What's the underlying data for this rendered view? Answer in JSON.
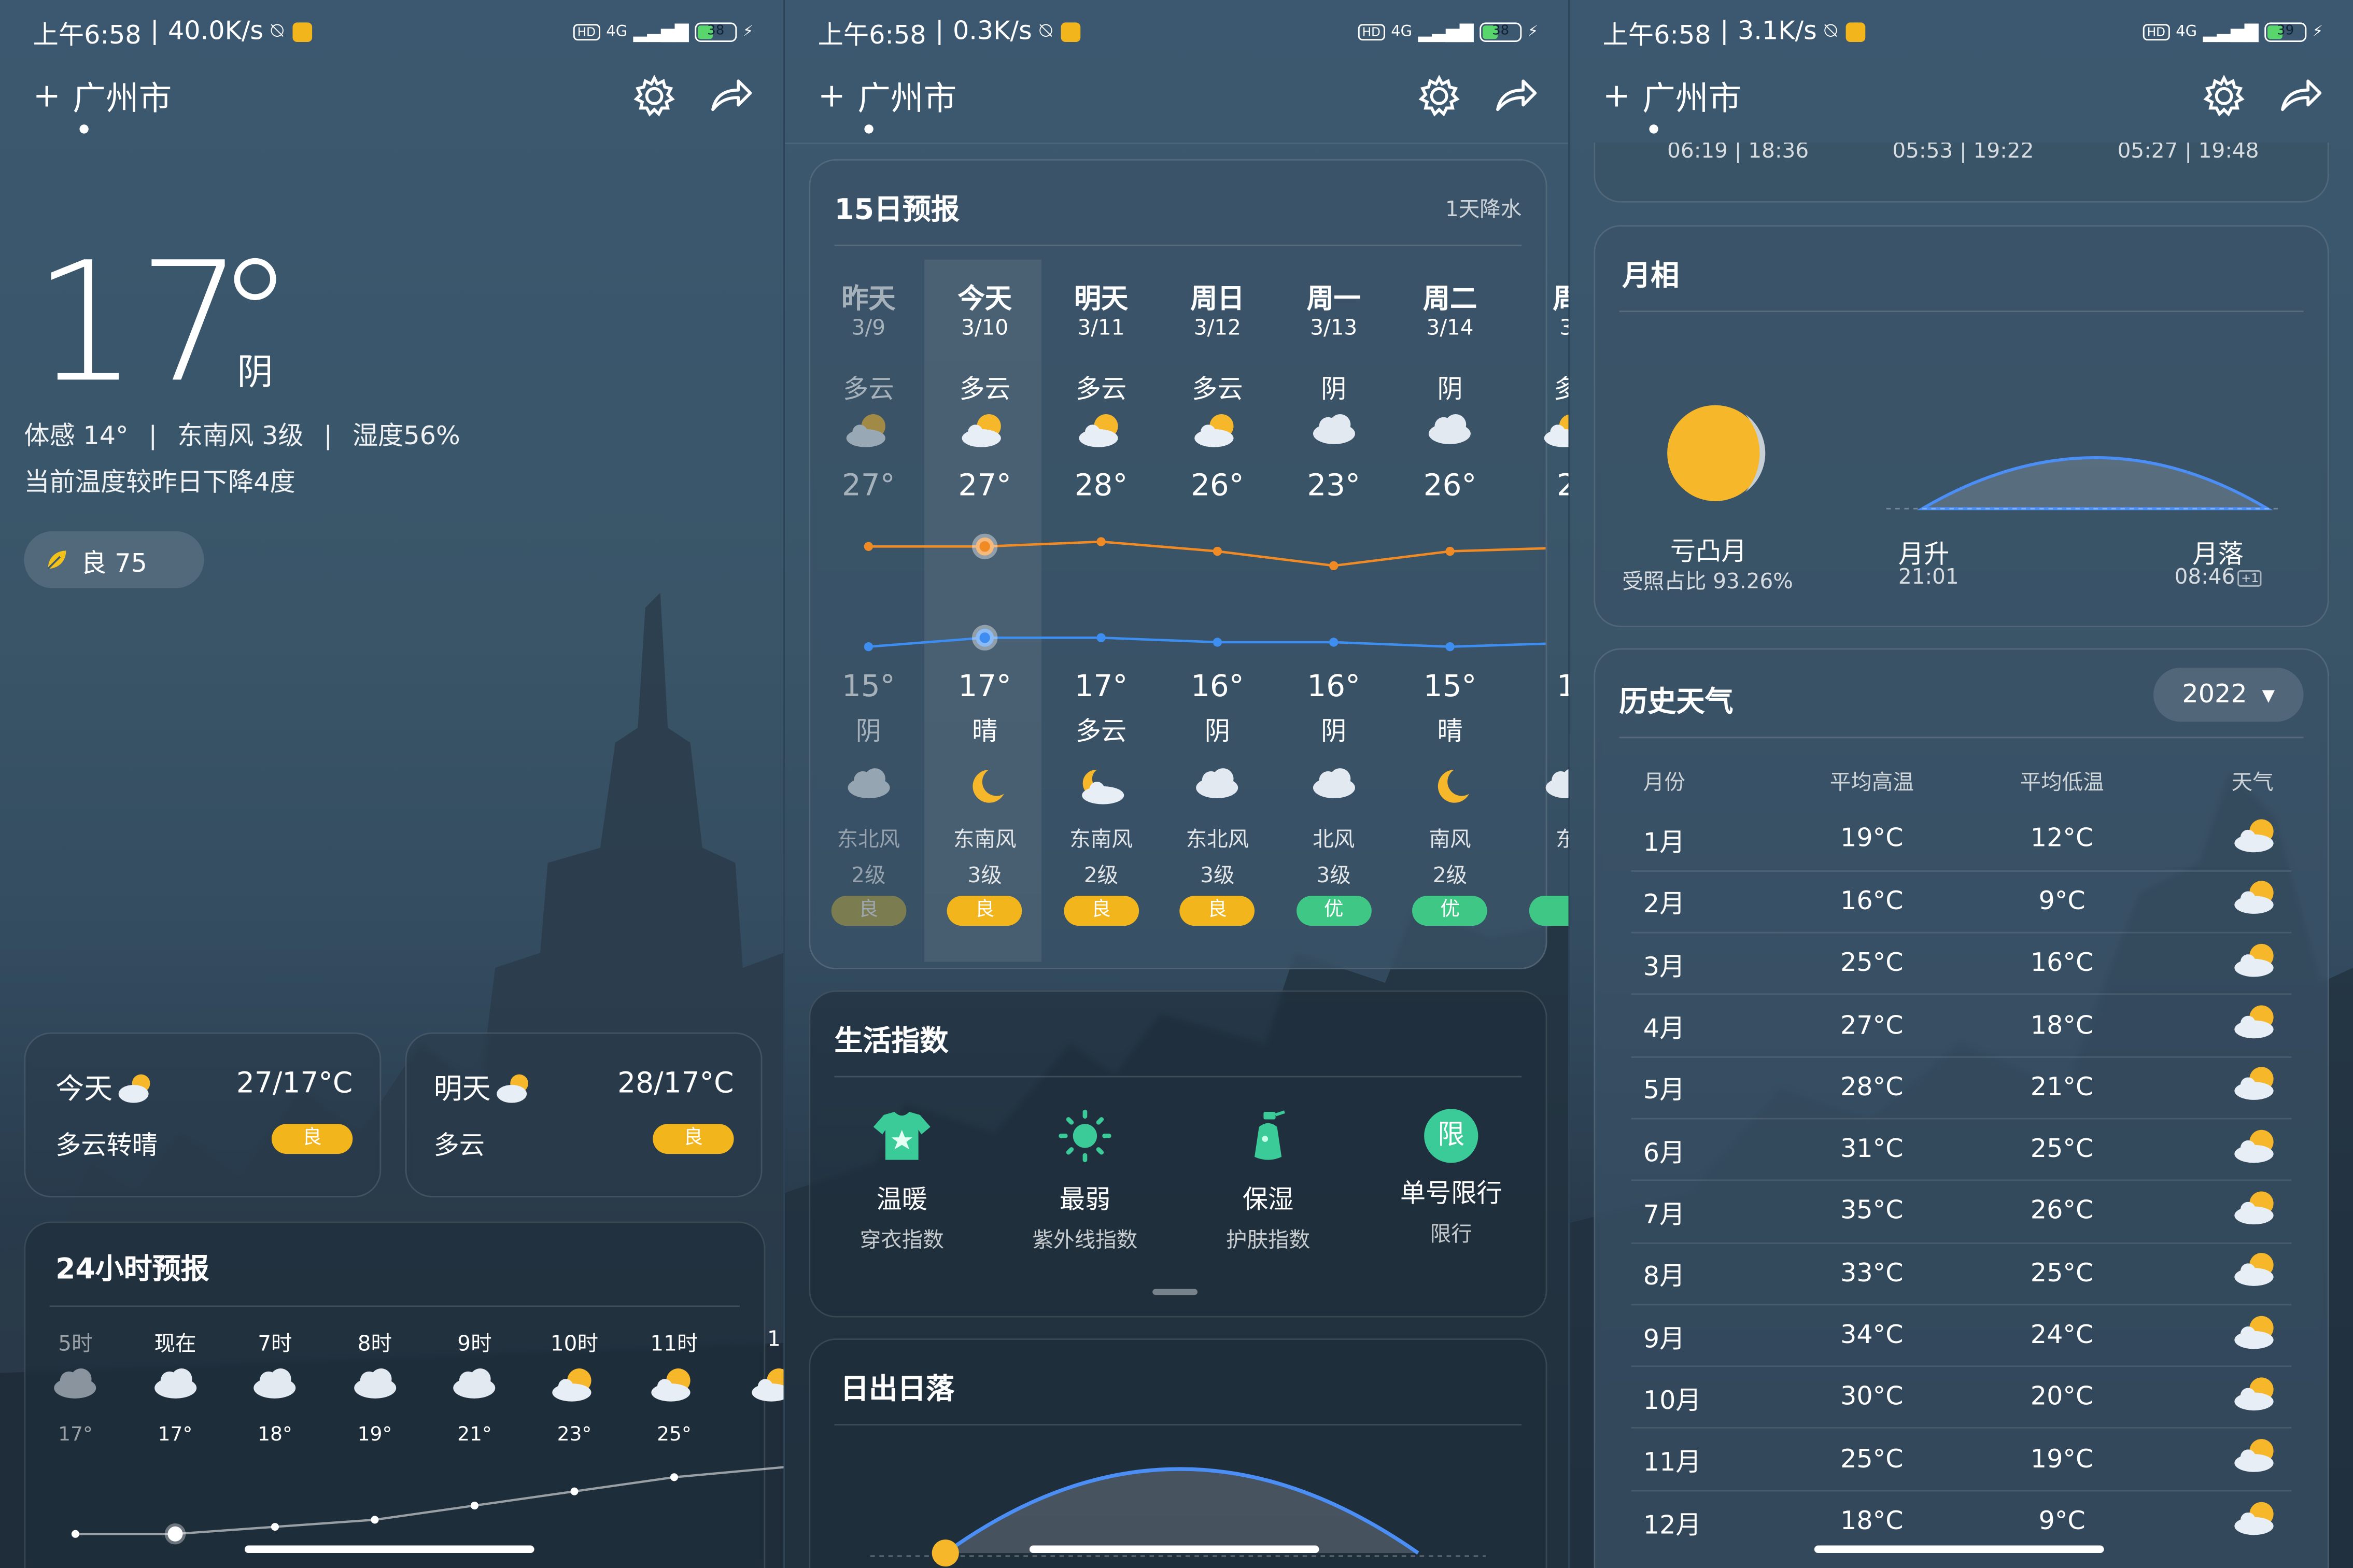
{
  "status_bar": [
    {
      "time": "上午6:58",
      "speed": "40.0K/s",
      "battery": "38"
    },
    {
      "time": "上午6:58",
      "speed": "0.3K/s",
      "battery": "38"
    },
    {
      "time": "上午6:58",
      "speed": "3.1K/s",
      "battery": "39"
    }
  ],
  "status_labels": {
    "hd": "HD",
    "net": "4G",
    "sep": "|"
  },
  "header": {
    "add": "+",
    "city": "广州市"
  },
  "current": {
    "temp": "17",
    "condition": "阴",
    "feels": "体感 14°",
    "wind": "东南风 3级",
    "humidity": "湿度56%",
    "compare": "当前温度较昨日下降4度",
    "aqi": "良 75"
  },
  "summary_cards": [
    {
      "day": "今天",
      "range": "27/17°C",
      "desc": "多云转晴",
      "aqi": "良"
    },
    {
      "day": "明天",
      "range": "28/17°C",
      "desc": "多云",
      "aqi": "良"
    }
  ],
  "hourly": {
    "title": "24小时预报",
    "hours": [
      {
        "time": "5时",
        "temp": "17°",
        "icon": "cloud-icon",
        "past": true
      },
      {
        "time": "现在",
        "temp": "17°",
        "icon": "cloud-icon"
      },
      {
        "time": "7时",
        "temp": "18°",
        "icon": "cloud-icon"
      },
      {
        "time": "8时",
        "temp": "19°",
        "icon": "cloud-icon"
      },
      {
        "time": "9时",
        "temp": "21°",
        "icon": "cloud-icon"
      },
      {
        "time": "10时",
        "temp": "23°",
        "icon": "partly-sunny-icon"
      },
      {
        "time": "11时",
        "temp": "25°",
        "icon": "partly-sunny-icon"
      },
      {
        "time": "1",
        "temp": "",
        "icon": "partly-sunny-icon"
      }
    ]
  },
  "forecast15": {
    "title": "15日预报",
    "note": "1天降水",
    "days": [
      {
        "day": "昨天",
        "date": "3/9",
        "day_cond": "多云",
        "high": "27°",
        "low": "15°",
        "night_cond": "阴",
        "wind": "东北风",
        "level": "2级",
        "aqi": "良",
        "day_icon": "partly-cloudy-icon",
        "night_icon": "cloud-icon",
        "past": true
      },
      {
        "day": "今天",
        "date": "3/10",
        "day_cond": "多云",
        "high": "27°",
        "low": "17°",
        "night_cond": "晴",
        "wind": "东南风",
        "level": "3级",
        "aqi": "良",
        "day_icon": "partly-cloudy-icon",
        "night_icon": "moon-icon"
      },
      {
        "day": "明天",
        "date": "3/11",
        "day_cond": "多云",
        "high": "28°",
        "low": "17°",
        "night_cond": "多云",
        "wind": "东南风",
        "level": "2级",
        "aqi": "良",
        "day_icon": "partly-cloudy-icon",
        "night_icon": "moon-cloud-icon"
      },
      {
        "day": "周日",
        "date": "3/12",
        "day_cond": "多云",
        "high": "26°",
        "low": "16°",
        "night_cond": "阴",
        "wind": "东北风",
        "level": "3级",
        "aqi": "良",
        "day_icon": "partly-cloudy-icon",
        "night_icon": "cloud-icon"
      },
      {
        "day": "周一",
        "date": "3/13",
        "day_cond": "阴",
        "high": "23°",
        "low": "16°",
        "night_cond": "阴",
        "wind": "北风",
        "level": "3级",
        "aqi": "优",
        "day_icon": "cloud-icon",
        "night_icon": "cloud-icon"
      },
      {
        "day": "周二",
        "date": "3/14",
        "day_cond": "阴",
        "high": "26°",
        "low": "15°",
        "night_cond": "晴",
        "wind": "南风",
        "level": "2级",
        "aqi": "优",
        "day_icon": "cloud-icon",
        "night_icon": "moon-icon"
      },
      {
        "day": "周",
        "date": "3",
        "day_cond": "多",
        "high": "2",
        "low": "1",
        "night_cond": "",
        "wind": "东",
        "level": "",
        "aqi": "",
        "day_icon": "partly-cloudy-icon",
        "night_icon": "cloud-icon"
      }
    ]
  },
  "life_index": {
    "title": "生活指数",
    "items": [
      {
        "value": "温暖",
        "label": "穿衣指数",
        "icon": "tshirt-icon"
      },
      {
        "value": "最弱",
        "label": "紫外线指数",
        "icon": "sun-icon"
      },
      {
        "value": "保湿",
        "label": "护肤指数",
        "icon": "lotion-icon"
      },
      {
        "value": "单号限行",
        "label": "限行",
        "icon": "restriction-icon",
        "badge": "限"
      }
    ]
  },
  "sunrise": {
    "title": "日出日落"
  },
  "sun_times_partial": [
    "06:19 | 18:36",
    "05:53 | 19:22",
    "05:27 | 19:48"
  ],
  "moon": {
    "title": "月相",
    "phase": "亏凸月",
    "illumination": "受照占比 93.26%",
    "rise_label": "月升",
    "rise_time": "21:01",
    "set_label": "月落",
    "set_time": "08:46",
    "next_day": "+1"
  },
  "history": {
    "title": "历史天气",
    "year": "2022",
    "headers": [
      "月份",
      "平均高温",
      "平均低温",
      "天气"
    ],
    "rows": [
      {
        "month": "1月",
        "high": "19°C",
        "low": "12°C"
      },
      {
        "month": "2月",
        "high": "16°C",
        "low": "9°C"
      },
      {
        "month": "3月",
        "high": "25°C",
        "low": "16°C"
      },
      {
        "month": "4月",
        "high": "27°C",
        "low": "18°C"
      },
      {
        "month": "5月",
        "high": "28°C",
        "low": "21°C"
      },
      {
        "month": "6月",
        "high": "31°C",
        "low": "25°C"
      },
      {
        "month": "7月",
        "high": "35°C",
        "low": "26°C"
      },
      {
        "month": "8月",
        "high": "33°C",
        "low": "25°C"
      },
      {
        "month": "9月",
        "high": "34°C",
        "low": "24°C"
      },
      {
        "month": "10月",
        "high": "30°C",
        "low": "20°C"
      },
      {
        "month": "11月",
        "high": "25°C",
        "low": "19°C"
      },
      {
        "month": "12月",
        "high": "18°C",
        "low": "9°C"
      }
    ]
  },
  "colors": {
    "high_line": "#f08a24",
    "low_line": "#3d8ef0",
    "good": "#f2b51b",
    "excellent": "#3fc785",
    "sun": "#f6b72a"
  }
}
